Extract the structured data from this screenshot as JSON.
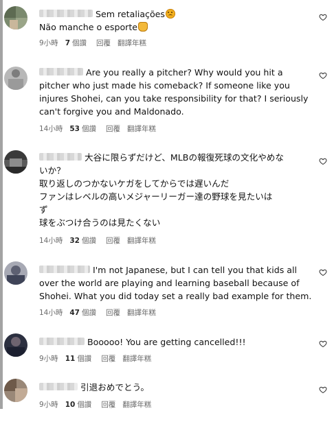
{
  "colors": {
    "heart": "#2b2b2b",
    "meta_text": "#6b6b6b"
  },
  "comments": [
    {
      "name_hidden": true,
      "lines": [
        "Sem retaliações",
        "Não manche o esporte"
      ],
      "emojis": [
        "sad-face-emoji",
        "clapping-hands-emoji"
      ],
      "time": "9小時",
      "likes_count": "7",
      "likes_unit": "個讚",
      "reply": "回覆",
      "translate": "翻譯年糕"
    },
    {
      "name_hidden": true,
      "lines": [
        "Are you really a pitcher? Why would you hit a",
        "pitcher who just made his comeback? If someone like you",
        "injures Shohei, can you take responsibility for that? I seriously",
        "can't forgive you and Maldonado."
      ],
      "time": "14小時",
      "likes_count": "53",
      "likes_unit": "個讚",
      "reply": "回覆",
      "translate": "翻譯年糕"
    },
    {
      "name_hidden": true,
      "lines": [
        "大谷に限らずだけど、MLBの報復死球の文化やめな",
        "いか？",
        "取り返しのつかないケガをしてからでは遅いんだ",
        "ファンはレベルの高いメジャーリーガー達の野球を見たいは",
        "ず",
        "球をぶつけ合うのは見たくない"
      ],
      "time": "14小時",
      "likes_count": "32",
      "likes_unit": "個讚",
      "reply": "回覆",
      "translate": "翻譯年糕"
    },
    {
      "name_hidden": true,
      "lines": [
        "I'm not Japanese, but I can tell you that kids all",
        "over the world are playing and learning baseball because of",
        "Shohei. What you did today set a really bad example for them."
      ],
      "time": "14小時",
      "likes_count": "47",
      "likes_unit": "個讚",
      "reply": "回覆",
      "translate": "翻譯年糕"
    },
    {
      "name_hidden": true,
      "lines": [
        "Booooo! You are getting cancelled!!!"
      ],
      "time": "9小時",
      "likes_count": "11",
      "likes_unit": "個讚",
      "reply": "回覆",
      "translate": "翻譯年糕"
    },
    {
      "name_hidden": true,
      "lines": [
        "引退おめでとう。"
      ],
      "time": "9小時",
      "likes_count": "10",
      "likes_unit": "個讚",
      "reply": "回覆",
      "translate": "翻譯年糕"
    }
  ]
}
